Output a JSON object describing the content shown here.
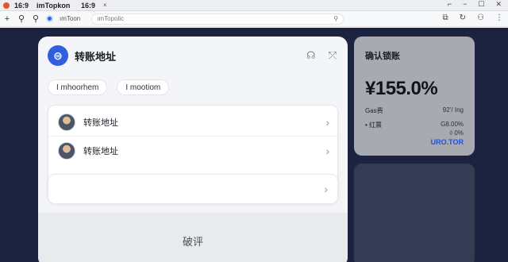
{
  "titlebar": {
    "left_label": "16:9",
    "app_name": "imTopkon",
    "tab_label": "16:9",
    "tab_close": "×",
    "controls": [
      "⌐",
      "−",
      "☐",
      "✕"
    ]
  },
  "navbar": {
    "site_name": "ımToon",
    "url_text": "ımTopolic",
    "icons": [
      "plus-icon",
      "search-icon",
      "search-icon",
      "pin-icon",
      "bookmark-icon",
      "user-icon",
      "more-icon"
    ]
  },
  "panel": {
    "title": "转账地址",
    "logo_glyph": "⊜",
    "chips": [
      "I mhoorhem",
      "I mootiom"
    ],
    "rows": [
      {
        "label": "转账地址"
      },
      {
        "label": "转账地址"
      }
    ],
    "bottom_label": "破评"
  },
  "right_card": {
    "title": "确认锁账",
    "amount": "¥155.0%",
    "gas_label": "Gas费",
    "gas_value": "92’/ Ing",
    "row2_label": "• 红票",
    "row2_value": "G8.00%",
    "row3_value": "◊ 0%",
    "link_text": "URO.TOR"
  },
  "colors": {
    "brand_blue": "#2f5fe0",
    "backdrop": "#1b2340",
    "link_blue": "#2353d6"
  }
}
